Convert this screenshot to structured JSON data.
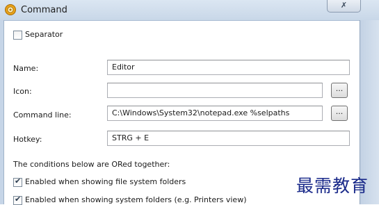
{
  "window": {
    "title": "Command",
    "close_glyph": "✗"
  },
  "separator": {
    "label": "Separator",
    "checked": false
  },
  "fields": {
    "name": {
      "label": "Name:",
      "value": "Editor"
    },
    "icon": {
      "label": "Icon:",
      "value": "",
      "browse": "..."
    },
    "command_line": {
      "label": "Command line:",
      "value": "C:\\Windows\\System32\\notepad.exe %selpaths",
      "browse": "..."
    },
    "hotkey": {
      "label": "Hotkey:",
      "value": "STRG + E"
    }
  },
  "conditions": {
    "intro": "The conditions below are ORed together:",
    "items": [
      {
        "label": "Enabled when showing file system folders",
        "checked": true
      },
      {
        "label": "Enabled when showing system folders (e.g. Printers view)",
        "checked": true
      }
    ]
  },
  "watermark": "最需教育",
  "icons": {
    "app": "app-cog-icon",
    "close": "close-icon",
    "checkmark": "checkmark-icon"
  },
  "colors": {
    "titlebar": "#dbe6f2",
    "frame": "#c3d2e4",
    "watermark": "#1a2a8a"
  }
}
